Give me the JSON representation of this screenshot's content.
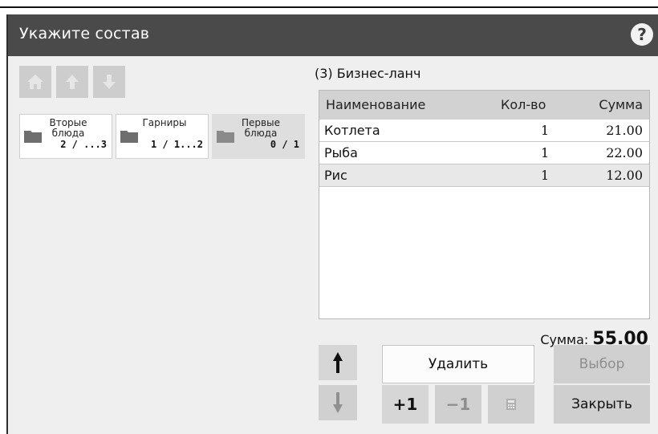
{
  "dialog": {
    "title": "Укажите состав",
    "help_label": "?"
  },
  "nav": {
    "home_icon": "home-icon",
    "up_icon": "arrow-up-icon",
    "down_icon": "arrow-down-icon"
  },
  "categories": [
    {
      "label": "Вторые блюда",
      "count": "2 / ...3"
    },
    {
      "label": "Гарниры",
      "count": "1 / 1...2"
    },
    {
      "label": "Первые блюда",
      "count": "0 / 1"
    }
  ],
  "group_title": "(3) Бизнес-ланч",
  "table": {
    "headers": {
      "name": "Наименование",
      "qty": "Кол-во",
      "sum": "Сумма"
    },
    "rows": [
      {
        "name": "Котлета",
        "qty": "1",
        "sum": "21.00"
      },
      {
        "name": "Рыба",
        "qty": "1",
        "sum": "22.00"
      },
      {
        "name": "Рис",
        "qty": "1",
        "sum": "12.00"
      }
    ]
  },
  "total": {
    "label": "Сумма:",
    "value": "55.00"
  },
  "buttons": {
    "delete": "Удалить",
    "select": "Выбор",
    "plus_one": "+1",
    "minus_one": "−1",
    "close": "Закрыть",
    "calculator_icon": "calculator-icon"
  },
  "colors": {
    "titlebar": "#4a4a4a",
    "panel": "#efefef",
    "header_row": "#d2d2d2"
  }
}
